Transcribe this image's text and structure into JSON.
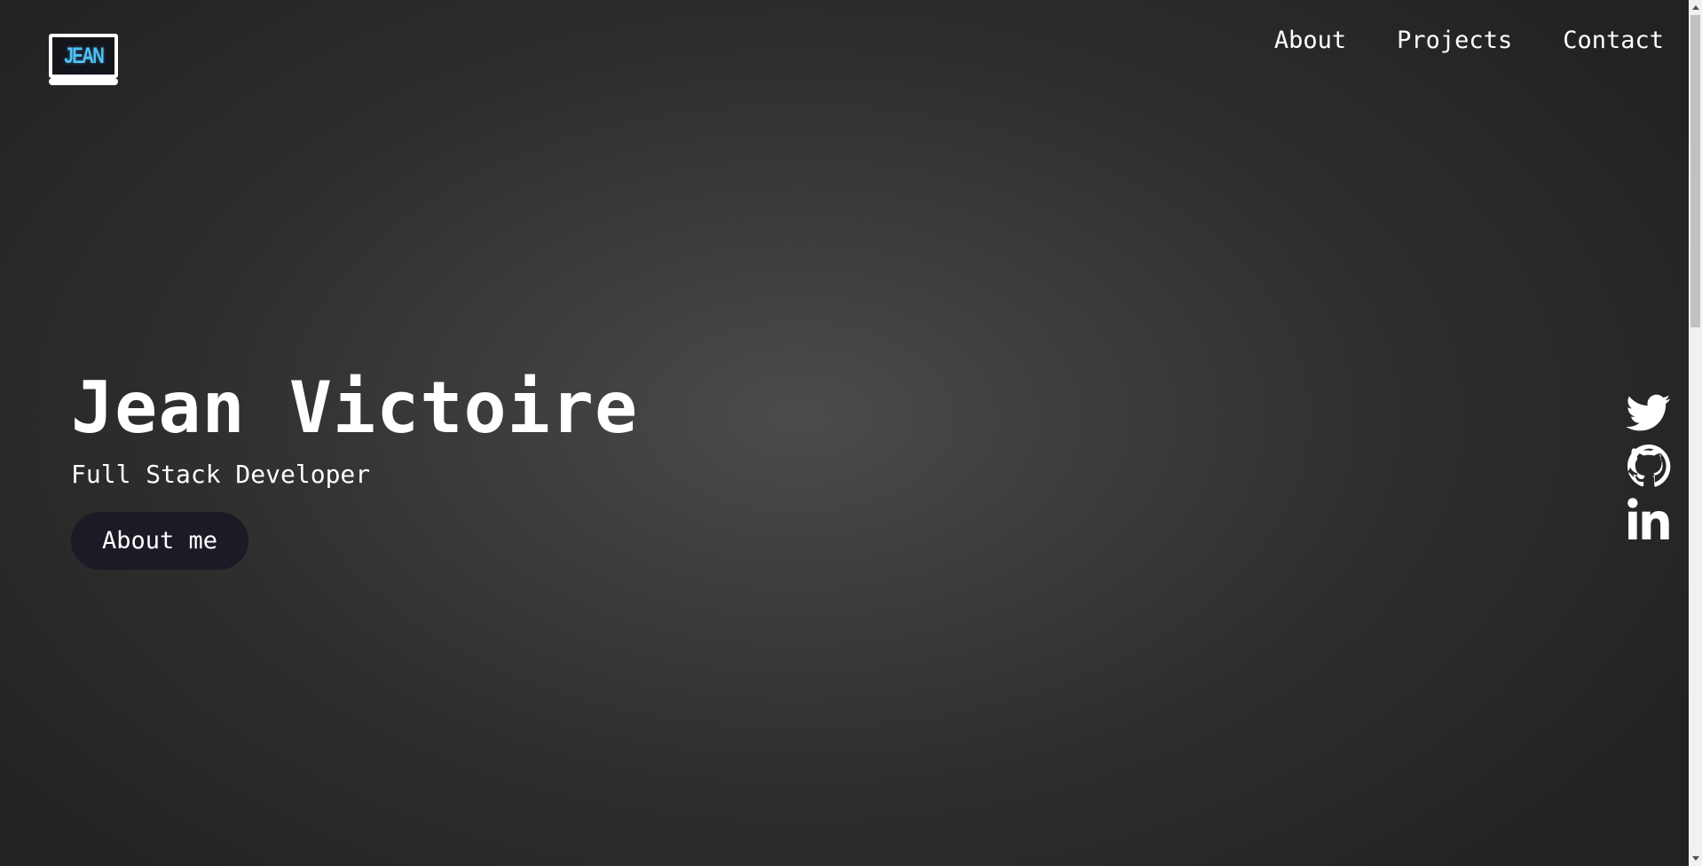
{
  "header": {
    "logo": {
      "text": "JEAN",
      "icon": "laptop-logo-icon"
    },
    "nav": [
      {
        "label": "About"
      },
      {
        "label": "Projects"
      },
      {
        "label": "Contact"
      }
    ]
  },
  "hero": {
    "name": "Jean Victoire",
    "role": "Full Stack Developer",
    "button_label": "About me"
  },
  "social": [
    {
      "icon": "twitter-icon"
    },
    {
      "icon": "github-icon"
    },
    {
      "icon": "linkedin-icon"
    }
  ],
  "colors": {
    "background_center": "#4b4b4b",
    "background_edge": "#222222",
    "button_bg": "#1b1b25",
    "logo_accent": "#4fc3f7",
    "text": "#ffffff"
  }
}
